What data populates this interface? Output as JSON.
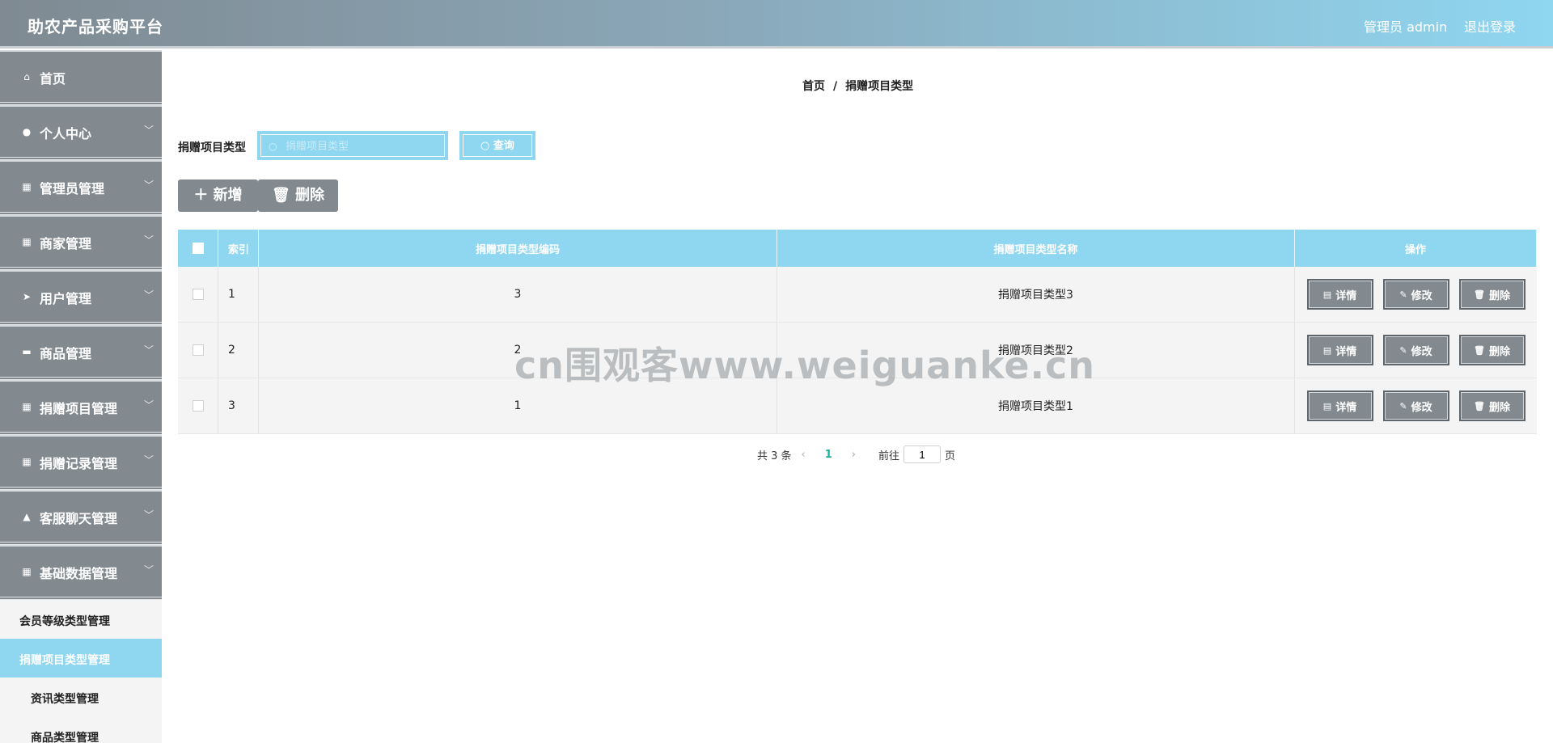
{
  "header": {
    "brand": "助农产品采购平台",
    "user": "管理员 admin",
    "logout": "退出登录"
  },
  "sidebar": {
    "items": [
      {
        "label": "首页",
        "icon": "home-icon",
        "chevron": false
      },
      {
        "label": "个人中心",
        "icon": "user-icon",
        "chevron": true
      },
      {
        "label": "管理员管理",
        "icon": "grid-icon",
        "chevron": true
      },
      {
        "label": "商家管理",
        "icon": "grid-icon",
        "chevron": true
      },
      {
        "label": "用户管理",
        "icon": "send-icon",
        "chevron": true
      },
      {
        "label": "商品管理",
        "icon": "chat-icon",
        "chevron": true
      },
      {
        "label": "捐赠项目管理",
        "icon": "apps-icon",
        "chevron": true
      },
      {
        "label": "捐赠记录管理",
        "icon": "grid-icon",
        "chevron": true
      },
      {
        "label": "客服聊天管理",
        "icon": "thumb-icon",
        "chevron": true
      },
      {
        "label": "基础数据管理",
        "icon": "grid-icon",
        "chevron": true
      }
    ],
    "subitems": [
      {
        "label": "会员等级类型管理",
        "active": false
      },
      {
        "label": "捐赠项目类型管理",
        "active": true
      },
      {
        "label": "资讯类型管理",
        "active": false
      },
      {
        "label": "商品类型管理",
        "active": false
      }
    ]
  },
  "breadcrumb": {
    "home": "首页",
    "sep": "/",
    "current": "捐赠项目类型"
  },
  "search": {
    "label": "捐赠项目类型",
    "placeholder": "捐赠项目类型",
    "button": "查询"
  },
  "actions": {
    "add": "新增",
    "delete": "删除"
  },
  "table": {
    "headers": {
      "index": "索引",
      "code": "捐赠项目类型编码",
      "name": "捐赠项目类型名称",
      "ops": "操作"
    },
    "rows": [
      {
        "index": "1",
        "code": "3",
        "name": "捐赠项目类型3"
      },
      {
        "index": "2",
        "code": "2",
        "name": "捐赠项目类型2"
      },
      {
        "index": "3",
        "code": "1",
        "name": "捐赠项目类型1"
      }
    ],
    "op_labels": {
      "detail": "详情",
      "edit": "修改",
      "delete": "删除"
    }
  },
  "pagination": {
    "total": "共 3 条",
    "current_page": "1",
    "goto_label": "前往",
    "goto_value": "1",
    "page_unit": "页"
  },
  "watermark": "cn围观客www.weiguanke.cn",
  "colors": {
    "accent": "#8fd6f0",
    "menu": "#838a8f",
    "page_active": "#14b3a0"
  }
}
